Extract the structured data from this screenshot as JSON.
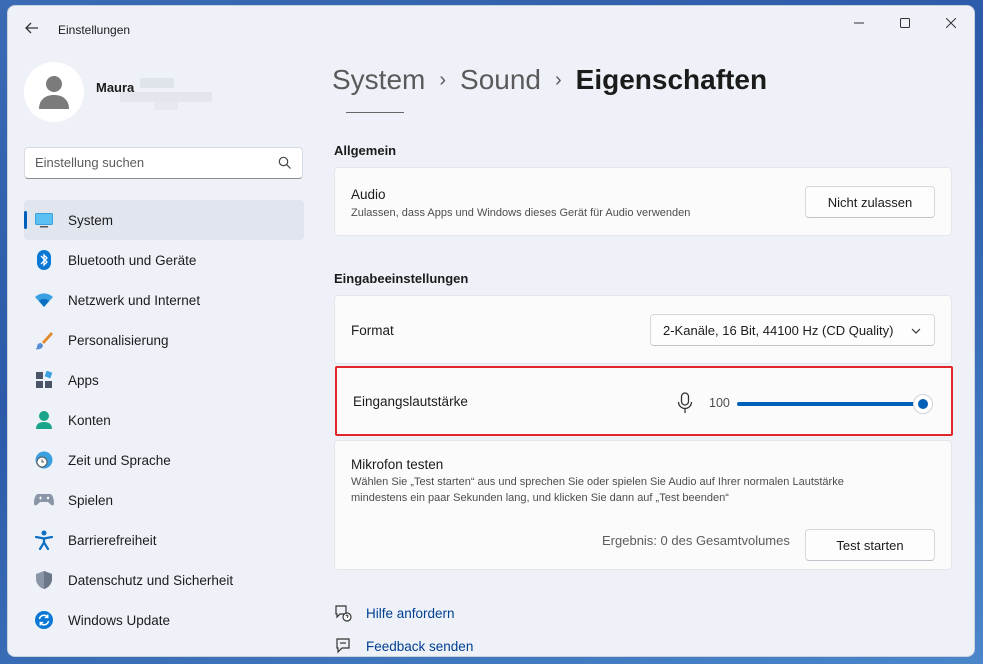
{
  "window": {
    "title": "Einstellungen"
  },
  "profile": {
    "name": "Maura"
  },
  "search": {
    "placeholder": "Einstellung suchen"
  },
  "nav": {
    "items": [
      {
        "label": "System",
        "icon": "monitor-icon"
      },
      {
        "label": "Bluetooth und Geräte",
        "icon": "bluetooth-icon"
      },
      {
        "label": "Netzwerk und Internet",
        "icon": "wifi-icon"
      },
      {
        "label": "Personalisierung",
        "icon": "brush-icon"
      },
      {
        "label": "Apps",
        "icon": "apps-icon"
      },
      {
        "label": "Konten",
        "icon": "person-icon"
      },
      {
        "label": "Zeit und Sprache",
        "icon": "clock-globe-icon"
      },
      {
        "label": "Spielen",
        "icon": "gamepad-icon"
      },
      {
        "label": "Barrierefreiheit",
        "icon": "accessibility-icon"
      },
      {
        "label": "Datenschutz und Sicherheit",
        "icon": "shield-icon"
      },
      {
        "label": "Windows Update",
        "icon": "update-icon"
      }
    ]
  },
  "breadcrumb": {
    "part1": "System",
    "part2": "Sound",
    "current": "Eigenschaften",
    "separator": "›"
  },
  "general": {
    "section_title": "Allgemein",
    "audio_title": "Audio",
    "audio_desc": "Zulassen, dass Apps und Windows dieses Gerät für Audio verwenden",
    "audio_button": "Nicht zulassen"
  },
  "input": {
    "section_title": "Eingabeeinstellungen",
    "format_label": "Format",
    "format_value": "2-Kanäle, 16 Bit, 44100 Hz (CD Quality)",
    "volume_label": "Eingangslautstärke",
    "volume_value": "100",
    "volume_level": 100,
    "test_title": "Mikrofon testen",
    "test_desc_line1": "Wählen Sie „Test starten“ aus und sprechen Sie oder spielen Sie Audio auf Ihrer normalen Lautstärke",
    "test_desc_line2": "mindestens ein paar Sekunden lang, und klicken Sie dann auf „Test beenden“",
    "result_text": "Ergebnis: 0 des Gesamtvolumes",
    "test_button": "Test starten"
  },
  "links": {
    "help": "Hilfe anfordern",
    "feedback": "Feedback senden"
  },
  "colors": {
    "accent": "#005fb8",
    "highlight_border": "#e2262a"
  }
}
